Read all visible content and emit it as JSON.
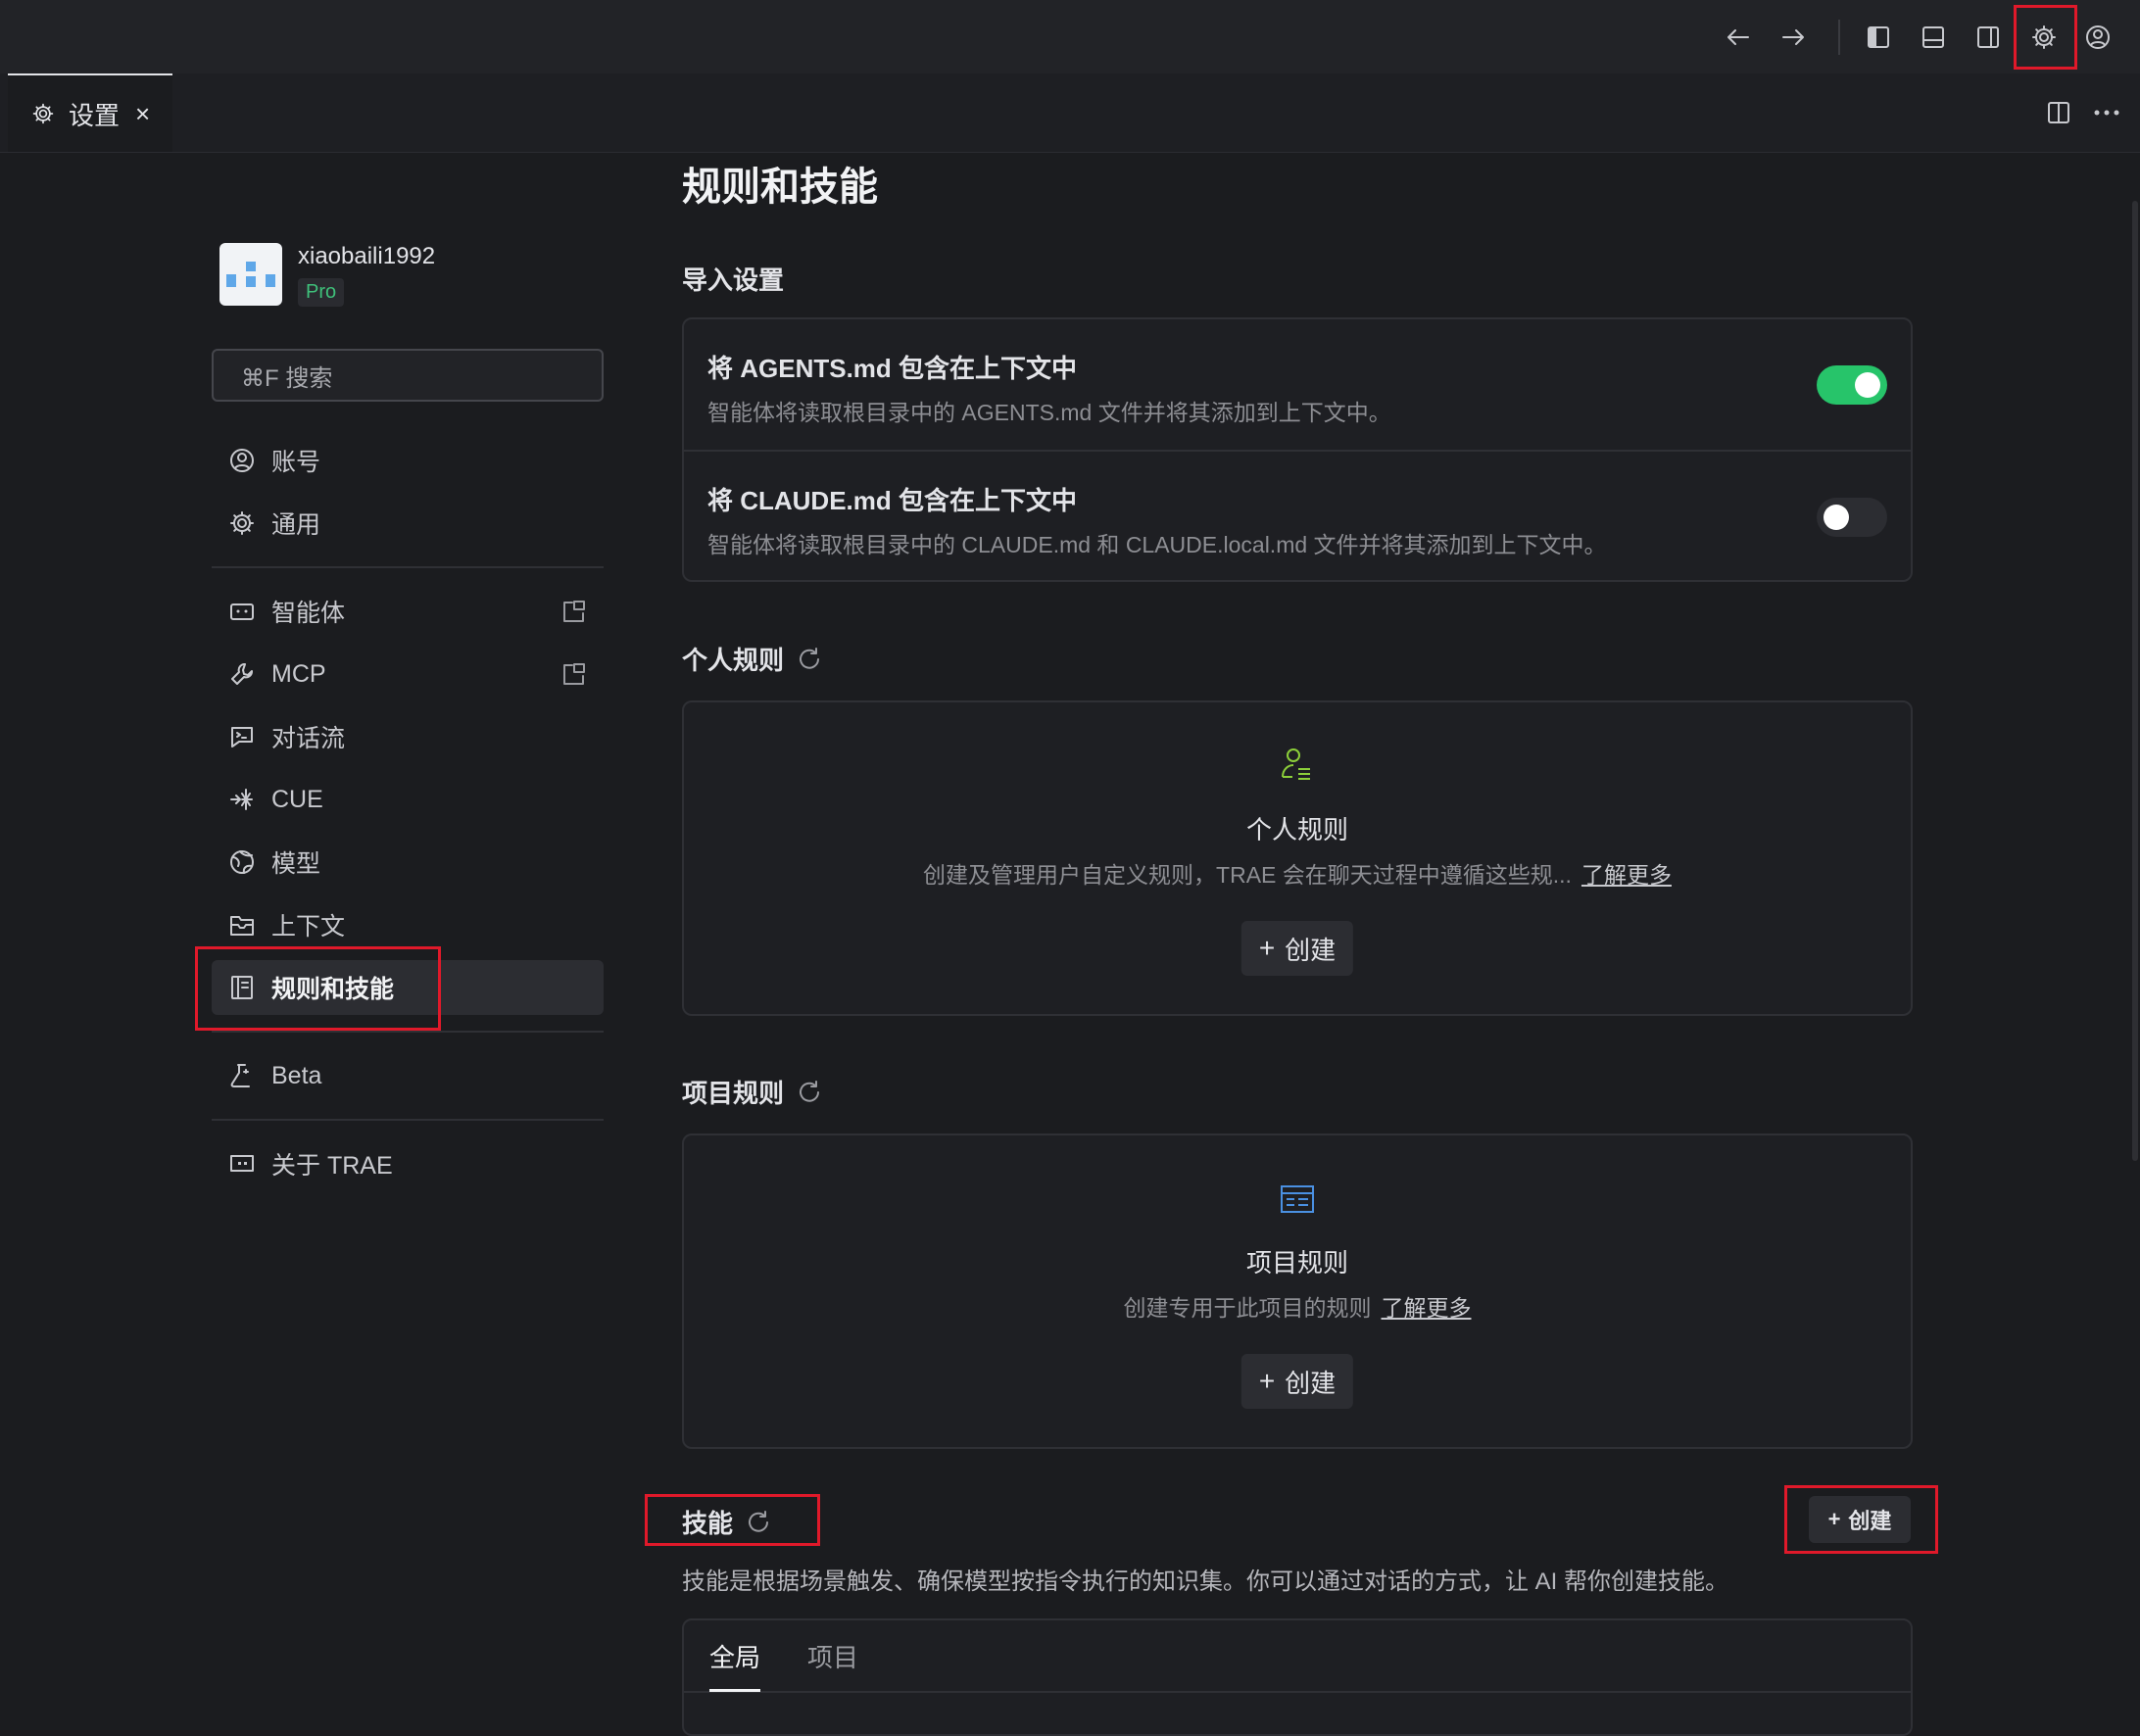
{
  "tab": {
    "label": "设置",
    "close": "×"
  },
  "user": {
    "name": "xiaobaili1992",
    "plan": "Pro"
  },
  "search": {
    "placeholder": "⌘F 搜索"
  },
  "nav": {
    "account": "账号",
    "general": "通用",
    "agents": "智能体",
    "mcp": "MCP",
    "conversation_flow": "对话流",
    "cue": "CUE",
    "models": "模型",
    "context": "上下文",
    "rules_skills": "规则和技能",
    "beta": "Beta",
    "about": "关于 TRAE"
  },
  "page": {
    "title": "规则和技能",
    "import_settings": {
      "title": "导入设置",
      "agents_md": {
        "title": "将 AGENTS.md 包含在上下文中",
        "desc": "智能体将读取根目录中的 AGENTS.md 文件并将其添加到上下文中。",
        "enabled": true
      },
      "claude_md": {
        "title": "将 CLAUDE.md 包含在上下文中",
        "desc": "智能体将读取根目录中的 CLAUDE.md 和 CLAUDE.local.md 文件并将其添加到上下文中。",
        "enabled": false
      }
    },
    "personal_rules": {
      "title": "个人规则",
      "empty_title": "个人规则",
      "empty_desc": "创建及管理用户自定义规则，TRAE 会在聊天过程中遵循这些规...",
      "learn_more": "了解更多",
      "create": "创建"
    },
    "project_rules": {
      "title": "项目规则",
      "empty_title": "项目规则",
      "empty_desc": "创建专用于此项目的规则",
      "learn_more": "了解更多",
      "create": "创建"
    },
    "skills": {
      "title": "技能",
      "create": "创建",
      "desc": "技能是根据场景触发、确保模型按指令执行的知识集。你可以通过对话的方式，让 AI 帮你创建技能。",
      "tabs": [
        "全局",
        "项目"
      ]
    }
  },
  "colors": {
    "accent_green": "#27c46a",
    "highlight_red": "#e0192a",
    "toggle_off": "#2c2d32"
  }
}
